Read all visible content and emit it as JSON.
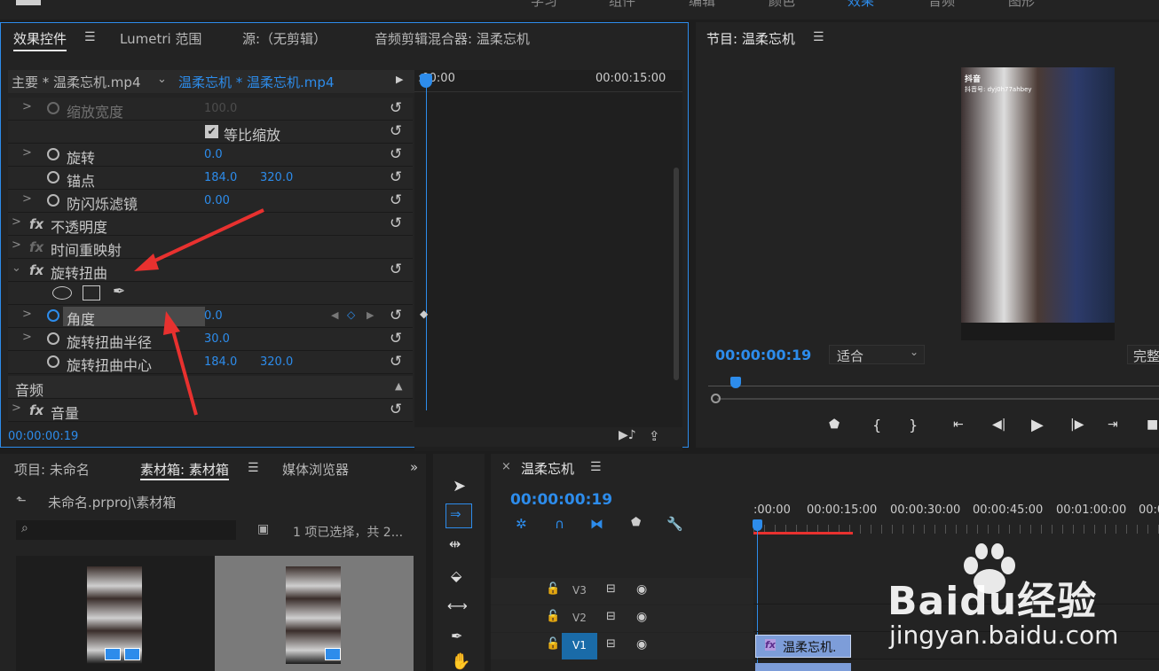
{
  "top_tabs": [
    "学习",
    "组件",
    "编辑",
    "颜色",
    "效果",
    "音频",
    "图形"
  ],
  "effect_controls": {
    "tabs": [
      "效果控件",
      "Lumetri 范围",
      "源:（无剪辑）",
      "音频剪辑混合器: 温柔忘机"
    ],
    "source_label": "主要 * 温柔忘机.mp4",
    "clip_label": "温柔忘机 * 温柔忘机.mp4",
    "ruler_start": ":00:00",
    "ruler_end": "00:00:15:00",
    "timecode": "00:00:00:19",
    "props": [
      {
        "name": "缩放宽度",
        "v1": "100.0",
        "v2": ""
      },
      {
        "name": "等比缩放",
        "v1": "",
        "v2": ""
      },
      {
        "name": "旋转",
        "v1": "0.0",
        "v2": ""
      },
      {
        "name": "锚点",
        "v1": "184.0",
        "v2": "320.0"
      },
      {
        "name": "防闪烁滤镜",
        "v1": "0.00",
        "v2": ""
      },
      {
        "name": "不透明度",
        "v1": "",
        "v2": ""
      },
      {
        "name": "时间重映射",
        "v1": "",
        "v2": ""
      },
      {
        "name": "旋转扭曲",
        "v1": "",
        "v2": ""
      },
      {
        "name": "",
        "v1": "",
        "v2": ""
      },
      {
        "name": "角度",
        "v1": "0.0",
        "v2": ""
      },
      {
        "name": "旋转扭曲半径",
        "v1": "30.0",
        "v2": ""
      },
      {
        "name": "旋转扭曲中心",
        "v1": "184.0",
        "v2": "320.0"
      },
      {
        "name": "音频",
        "v1": "",
        "v2": ""
      },
      {
        "name": "音量",
        "v1": "",
        "v2": ""
      }
    ]
  },
  "program": {
    "title": "节目: 温柔忘机",
    "timecode": "00:00:00:19",
    "fit": "适合",
    "full": "完整",
    "overlay_brand": "抖音",
    "overlay_id": "抖音号: dyj0h77ahbey"
  },
  "project": {
    "tabs": [
      "项目: 未命名",
      "素材箱: 素材箱",
      "媒体浏览器"
    ],
    "path": "未命名.prproj\\素材箱",
    "selection": "1 项已选择，共 2..."
  },
  "sequence": {
    "title": "温柔忘机",
    "timecode": "00:00:00:19",
    "ruler": [
      ":00:00",
      "00:00:15:00",
      "00:00:30:00",
      "00:00:45:00",
      "00:01:00:00",
      "00:0"
    ],
    "tracks": [
      "V3",
      "V2",
      "V1"
    ],
    "clip": "温柔忘机."
  },
  "watermark": {
    "brand": "Baidu经验",
    "url": "jingyan.baidu.com"
  },
  "colors": {
    "accent": "#2d8ceb",
    "panel": "#232323",
    "arrow": "#e8312f"
  }
}
